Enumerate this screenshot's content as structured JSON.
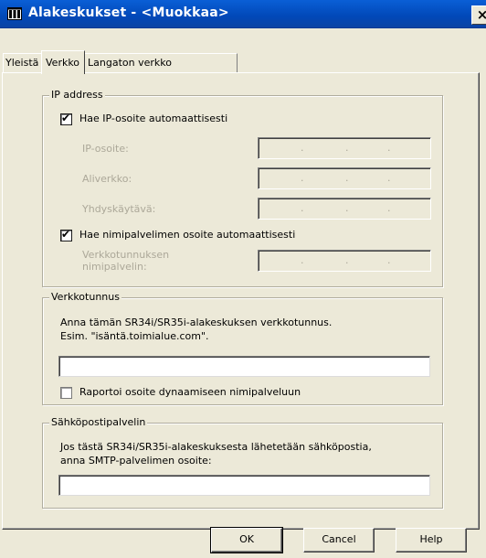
{
  "window": {
    "title": "Alakeskukset - <Muokkaa>",
    "close_glyph": "×"
  },
  "tabs": [
    {
      "label": "Yleistä",
      "active": false
    },
    {
      "label": "Verkko",
      "active": true
    },
    {
      "label": "Langaton verkko",
      "active": false
    }
  ],
  "ip_group": {
    "legend": "IP address",
    "auto_ip_checkbox": {
      "label": "Hae IP-osoite automaattisesti",
      "checked": true
    },
    "fields": [
      {
        "label": "IP-osoite:",
        "value": ". . ."
      },
      {
        "label": "Aliverkko:",
        "value": ". . ."
      },
      {
        "label": "Yhdyskäytävä:",
        "value": ". . ."
      }
    ],
    "auto_dns_checkbox": {
      "label": "Hae nimipalvelimen osoite automaattisesti",
      "checked": true
    },
    "dns_field": {
      "label_line1": "Verkkotunnuksen",
      "label_line2": "nimipalvelin:"
    }
  },
  "domain_group": {
    "legend": "Verkkotunnus",
    "description_line1": "Anna tämän SR34i/SR35i-alakeskuksen verkkotunnus.",
    "description_line2": "Esim. \"isäntä.toimialue.com\".",
    "input_value": "",
    "report_checkbox": {
      "label": "Raportoi osoite dynaamiseen nimipalveluun",
      "checked": false
    }
  },
  "mail_group": {
    "legend": "Sähköpostipalvelin",
    "description_line1": "Jos tästä SR34i/SR35i-alakeskuksesta lähetetään sähköpostia,",
    "description_line2": "anna SMTP-palvelimen osoite:",
    "input_value": ""
  },
  "buttons": {
    "ok": "OK",
    "cancel": "Cancel",
    "help": "Help"
  },
  "colors": {
    "titlebar": "#0148b8",
    "dialog_bg": "#ece9d8",
    "disabled_text": "#aca899"
  }
}
